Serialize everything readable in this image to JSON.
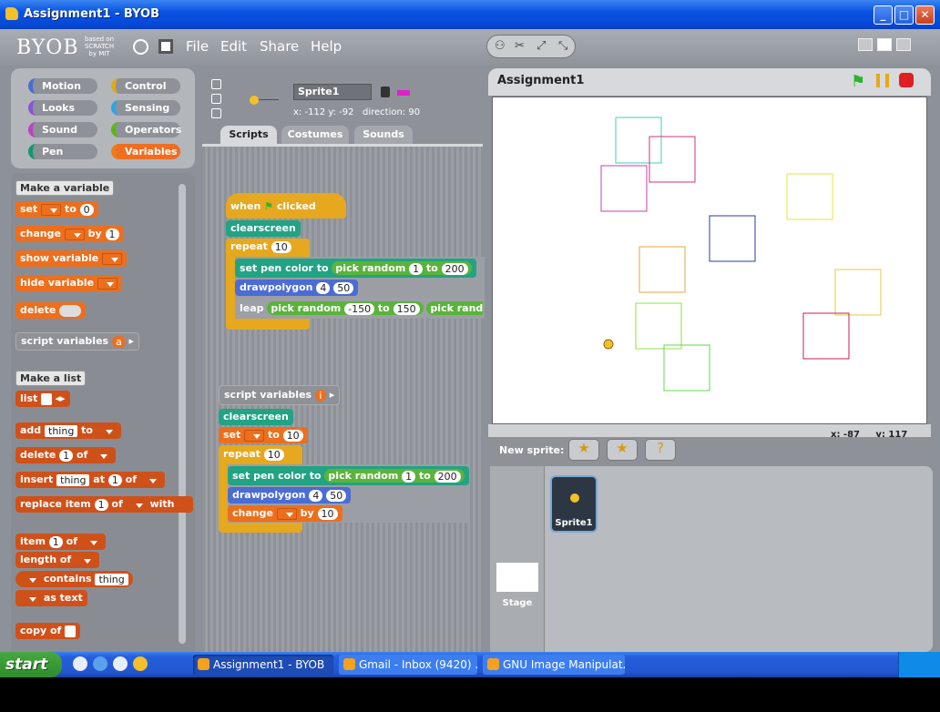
{
  "window": {
    "title": "Assignment1 - BYOB",
    "buttons": {
      "minimize": "_",
      "maximize": "□",
      "close": "✕"
    }
  },
  "app": {
    "logo": "BYOB",
    "logo_sub": "based on SCRATCH by MIT",
    "menu": [
      "File",
      "Edit",
      "Share",
      "Help"
    ]
  },
  "categories": [
    {
      "label": "Motion",
      "color": "#4a6cd4"
    },
    {
      "label": "Control",
      "color": "#e1a91a"
    },
    {
      "label": "Looks",
      "color": "#8a55d7"
    },
    {
      "label": "Sensing",
      "color": "#2ca5e2"
    },
    {
      "label": "Sound",
      "color": "#bb42c3"
    },
    {
      "label": "Operators",
      "color": "#5cb712"
    },
    {
      "label": "Pen",
      "color": "#0e9a6c"
    },
    {
      "label": "Variables",
      "color": "#ee7d16"
    }
  ],
  "palette": {
    "make_variable": "Make a variable",
    "set": "set",
    "to": "to",
    "set_val": "0",
    "change": "change",
    "by": "by",
    "change_val": "1",
    "show_variable": "show variable",
    "hide_variable": "hide variable",
    "delete": "delete",
    "script_variables": "script variables",
    "script_var_a": "a",
    "make_list": "Make a list",
    "list": "list",
    "add": "add",
    "thing": "thing",
    "delete_list": "delete",
    "of": "of",
    "one": "1",
    "insert": "insert",
    "at": "at",
    "replace_item": "replace item",
    "with": "with",
    "item": "item",
    "length_of": "length of",
    "contains": "contains",
    "as_text": "as text",
    "copy_of": "copy of"
  },
  "sprite": {
    "name": "Sprite1",
    "x_label": "x: -112",
    "y_label": "y: -92",
    "direction_label": "direction: 90"
  },
  "tabs": [
    "Scripts",
    "Costumes",
    "Sounds"
  ],
  "script1": {
    "hat_when": "when",
    "hat_clicked": "clicked",
    "clearscreen": "clearscreen",
    "repeat": "repeat",
    "repeat_n": "10",
    "set_pen_color": "set pen color to",
    "pick_random": "pick random",
    "r_from": "1",
    "r_to_label": "to",
    "r_to": "200",
    "drawpolygon": "drawpolygon",
    "dp_a": "4",
    "dp_b": "50",
    "leap": "leap",
    "leap_from": "-150",
    "leap_to": "150",
    "leap_tail": "pick rando"
  },
  "script2": {
    "script_variables": "script variables",
    "var": "i",
    "clearscreen": "clearscreen",
    "set": "set",
    "to": "to",
    "set_val": "10",
    "repeat": "repeat",
    "repeat_n": "10",
    "set_pen_color": "set pen color to",
    "pick_random": "pick random",
    "r_from": "1",
    "r_to_label": "to",
    "r_to": "200",
    "drawpolygon": "drawpolygon",
    "dp_a": "4",
    "dp_b": "50",
    "change": "change",
    "by": "by",
    "change_val": "10"
  },
  "stage": {
    "title": "Assignment1",
    "mouse_x": "x: -87",
    "mouse_y": "y: 117",
    "new_sprite": "New sprite:",
    "squares": [
      {
        "color": "#3ed2b6"
      },
      {
        "color": "#d4307a"
      },
      {
        "color": "#c93dbd"
      },
      {
        "color": "#e8e33a"
      },
      {
        "color": "#2a3aa8"
      },
      {
        "color": "#eea63a"
      },
      {
        "color": "#eac83a"
      },
      {
        "color": "#8fe24a"
      },
      {
        "color": "#c81e5a"
      },
      {
        "color": "#5ed94a"
      }
    ]
  },
  "corral": {
    "sprite_label": "Sprite1",
    "stage_label": "Stage"
  },
  "taskbar": {
    "start": "start",
    "tasks": [
      "Assignment1 - BYOB",
      "Gmail - Inbox (9420) ...",
      "GNU Image Manipulat..."
    ]
  }
}
